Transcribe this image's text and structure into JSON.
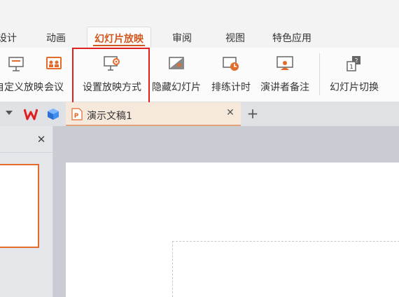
{
  "menu": {
    "tabs": [
      {
        "label": "设计"
      },
      {
        "label": "动画"
      },
      {
        "label": "幻灯片放映"
      },
      {
        "label": "审阅"
      },
      {
        "label": "视图"
      },
      {
        "label": "特色应用"
      }
    ],
    "active_index": 2
  },
  "ribbon": {
    "buttons": [
      {
        "label": "自定义放映",
        "icon": "custom-show-icon"
      },
      {
        "label": "会议",
        "icon": "meeting-icon"
      },
      {
        "label": "设置放映方式",
        "icon": "slideshow-settings-icon"
      },
      {
        "label": "隐藏幻灯片",
        "icon": "hide-slide-icon"
      },
      {
        "label": "排练计时",
        "icon": "rehearse-timing-icon"
      },
      {
        "label": "演讲者备注",
        "icon": "speaker-notes-icon"
      },
      {
        "label": "幻灯片切换",
        "icon": "slide-transition-icon"
      }
    ]
  },
  "docbar": {
    "tab_title": "演示文稿1",
    "close_glyph": "✕",
    "add_glyph": "+"
  },
  "pane": {
    "close_glyph": "✕"
  },
  "colors": {
    "accent": "#d0581e",
    "highlight": "#e02020",
    "thumb_border": "#e36b2c"
  }
}
